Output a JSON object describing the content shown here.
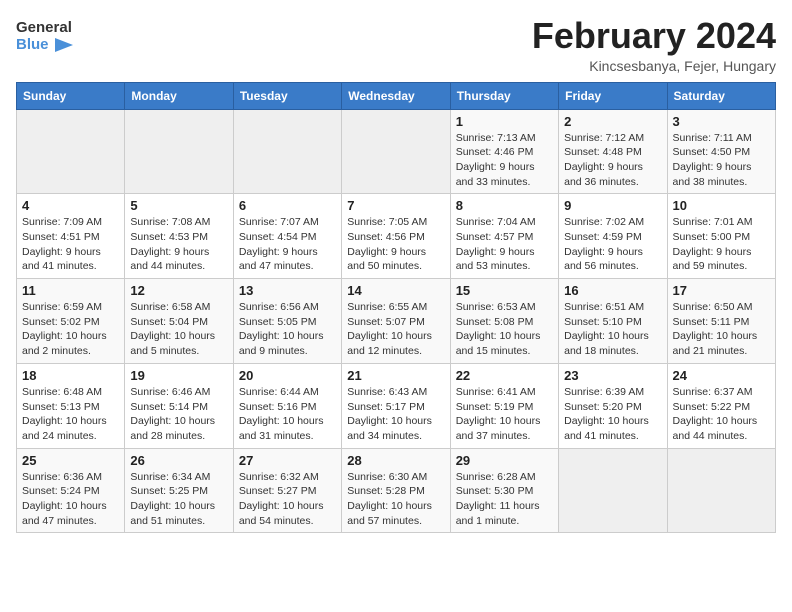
{
  "header": {
    "logo_line1": "General",
    "logo_line2": "Blue",
    "month_year": "February 2024",
    "location": "Kincsesbanya, Fejer, Hungary"
  },
  "weekdays": [
    "Sunday",
    "Monday",
    "Tuesday",
    "Wednesday",
    "Thursday",
    "Friday",
    "Saturday"
  ],
  "weeks": [
    [
      {
        "day": "",
        "sunrise": "",
        "sunset": "",
        "daylight": ""
      },
      {
        "day": "",
        "sunrise": "",
        "sunset": "",
        "daylight": ""
      },
      {
        "day": "",
        "sunrise": "",
        "sunset": "",
        "daylight": ""
      },
      {
        "day": "",
        "sunrise": "",
        "sunset": "",
        "daylight": ""
      },
      {
        "day": "1",
        "sunrise": "Sunrise: 7:13 AM",
        "sunset": "Sunset: 4:46 PM",
        "daylight": "Daylight: 9 hours and 33 minutes."
      },
      {
        "day": "2",
        "sunrise": "Sunrise: 7:12 AM",
        "sunset": "Sunset: 4:48 PM",
        "daylight": "Daylight: 9 hours and 36 minutes."
      },
      {
        "day": "3",
        "sunrise": "Sunrise: 7:11 AM",
        "sunset": "Sunset: 4:50 PM",
        "daylight": "Daylight: 9 hours and 38 minutes."
      }
    ],
    [
      {
        "day": "4",
        "sunrise": "Sunrise: 7:09 AM",
        "sunset": "Sunset: 4:51 PM",
        "daylight": "Daylight: 9 hours and 41 minutes."
      },
      {
        "day": "5",
        "sunrise": "Sunrise: 7:08 AM",
        "sunset": "Sunset: 4:53 PM",
        "daylight": "Daylight: 9 hours and 44 minutes."
      },
      {
        "day": "6",
        "sunrise": "Sunrise: 7:07 AM",
        "sunset": "Sunset: 4:54 PM",
        "daylight": "Daylight: 9 hours and 47 minutes."
      },
      {
        "day": "7",
        "sunrise": "Sunrise: 7:05 AM",
        "sunset": "Sunset: 4:56 PM",
        "daylight": "Daylight: 9 hours and 50 minutes."
      },
      {
        "day": "8",
        "sunrise": "Sunrise: 7:04 AM",
        "sunset": "Sunset: 4:57 PM",
        "daylight": "Daylight: 9 hours and 53 minutes."
      },
      {
        "day": "9",
        "sunrise": "Sunrise: 7:02 AM",
        "sunset": "Sunset: 4:59 PM",
        "daylight": "Daylight: 9 hours and 56 minutes."
      },
      {
        "day": "10",
        "sunrise": "Sunrise: 7:01 AM",
        "sunset": "Sunset: 5:00 PM",
        "daylight": "Daylight: 9 hours and 59 minutes."
      }
    ],
    [
      {
        "day": "11",
        "sunrise": "Sunrise: 6:59 AM",
        "sunset": "Sunset: 5:02 PM",
        "daylight": "Daylight: 10 hours and 2 minutes."
      },
      {
        "day": "12",
        "sunrise": "Sunrise: 6:58 AM",
        "sunset": "Sunset: 5:04 PM",
        "daylight": "Daylight: 10 hours and 5 minutes."
      },
      {
        "day": "13",
        "sunrise": "Sunrise: 6:56 AM",
        "sunset": "Sunset: 5:05 PM",
        "daylight": "Daylight: 10 hours and 9 minutes."
      },
      {
        "day": "14",
        "sunrise": "Sunrise: 6:55 AM",
        "sunset": "Sunset: 5:07 PM",
        "daylight": "Daylight: 10 hours and 12 minutes."
      },
      {
        "day": "15",
        "sunrise": "Sunrise: 6:53 AM",
        "sunset": "Sunset: 5:08 PM",
        "daylight": "Daylight: 10 hours and 15 minutes."
      },
      {
        "day": "16",
        "sunrise": "Sunrise: 6:51 AM",
        "sunset": "Sunset: 5:10 PM",
        "daylight": "Daylight: 10 hours and 18 minutes."
      },
      {
        "day": "17",
        "sunrise": "Sunrise: 6:50 AM",
        "sunset": "Sunset: 5:11 PM",
        "daylight": "Daylight: 10 hours and 21 minutes."
      }
    ],
    [
      {
        "day": "18",
        "sunrise": "Sunrise: 6:48 AM",
        "sunset": "Sunset: 5:13 PM",
        "daylight": "Daylight: 10 hours and 24 minutes."
      },
      {
        "day": "19",
        "sunrise": "Sunrise: 6:46 AM",
        "sunset": "Sunset: 5:14 PM",
        "daylight": "Daylight: 10 hours and 28 minutes."
      },
      {
        "day": "20",
        "sunrise": "Sunrise: 6:44 AM",
        "sunset": "Sunset: 5:16 PM",
        "daylight": "Daylight: 10 hours and 31 minutes."
      },
      {
        "day": "21",
        "sunrise": "Sunrise: 6:43 AM",
        "sunset": "Sunset: 5:17 PM",
        "daylight": "Daylight: 10 hours and 34 minutes."
      },
      {
        "day": "22",
        "sunrise": "Sunrise: 6:41 AM",
        "sunset": "Sunset: 5:19 PM",
        "daylight": "Daylight: 10 hours and 37 minutes."
      },
      {
        "day": "23",
        "sunrise": "Sunrise: 6:39 AM",
        "sunset": "Sunset: 5:20 PM",
        "daylight": "Daylight: 10 hours and 41 minutes."
      },
      {
        "day": "24",
        "sunrise": "Sunrise: 6:37 AM",
        "sunset": "Sunset: 5:22 PM",
        "daylight": "Daylight: 10 hours and 44 minutes."
      }
    ],
    [
      {
        "day": "25",
        "sunrise": "Sunrise: 6:36 AM",
        "sunset": "Sunset: 5:24 PM",
        "daylight": "Daylight: 10 hours and 47 minutes."
      },
      {
        "day": "26",
        "sunrise": "Sunrise: 6:34 AM",
        "sunset": "Sunset: 5:25 PM",
        "daylight": "Daylight: 10 hours and 51 minutes."
      },
      {
        "day": "27",
        "sunrise": "Sunrise: 6:32 AM",
        "sunset": "Sunset: 5:27 PM",
        "daylight": "Daylight: 10 hours and 54 minutes."
      },
      {
        "day": "28",
        "sunrise": "Sunrise: 6:30 AM",
        "sunset": "Sunset: 5:28 PM",
        "daylight": "Daylight: 10 hours and 57 minutes."
      },
      {
        "day": "29",
        "sunrise": "Sunrise: 6:28 AM",
        "sunset": "Sunset: 5:30 PM",
        "daylight": "Daylight: 11 hours and 1 minute."
      },
      {
        "day": "",
        "sunrise": "",
        "sunset": "",
        "daylight": ""
      },
      {
        "day": "",
        "sunrise": "",
        "sunset": "",
        "daylight": ""
      }
    ]
  ]
}
